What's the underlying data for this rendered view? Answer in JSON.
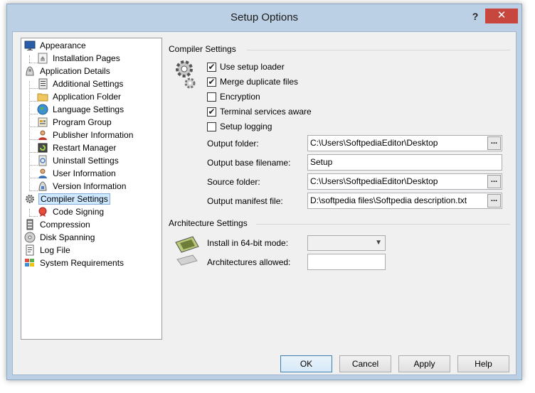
{
  "window": {
    "title": "Setup Options",
    "help_glyph": "?",
    "close_glyph": "✕"
  },
  "tree": {
    "items": [
      {
        "label": "Appearance",
        "icon": "monitor-icon"
      },
      {
        "label": "Installation Pages",
        "icon": "page-icon"
      },
      {
        "label": "Application Details",
        "icon": "app-icon"
      },
      {
        "label": "Additional Settings",
        "icon": "settings-icon"
      },
      {
        "label": "Application Folder",
        "icon": "folder-icon"
      },
      {
        "label": "Language Settings",
        "icon": "globe-icon"
      },
      {
        "label": "Program Group",
        "icon": "program-group-icon"
      },
      {
        "label": "Publisher Information",
        "icon": "user-icon"
      },
      {
        "label": "Restart Manager",
        "icon": "restart-icon"
      },
      {
        "label": "Uninstall Settings",
        "icon": "uninstall-icon"
      },
      {
        "label": "User Information",
        "icon": "user-info-icon"
      },
      {
        "label": "Version Information",
        "icon": "version-icon"
      },
      {
        "label": "Compiler Settings",
        "icon": "gear-icon"
      },
      {
        "label": "Code Signing",
        "icon": "certificate-icon"
      },
      {
        "label": "Compression",
        "icon": "compression-icon"
      },
      {
        "label": "Disk Spanning",
        "icon": "disk-icon"
      },
      {
        "label": "Log File",
        "icon": "log-icon"
      },
      {
        "label": "System Requirements",
        "icon": "windows-icon"
      }
    ],
    "selected": "Compiler Settings"
  },
  "compiler": {
    "section_title": "Compiler Settings",
    "checkboxes": [
      {
        "label": "Use setup loader",
        "checked": true
      },
      {
        "label": "Merge duplicate files",
        "checked": true
      },
      {
        "label": "Encryption",
        "checked": false
      },
      {
        "label": "Terminal services aware",
        "checked": true
      },
      {
        "label": "Setup logging",
        "checked": false
      }
    ],
    "check_mark": "✔",
    "fields": [
      {
        "label": "Output folder:",
        "value": "C:\\Users\\SoftpediaEditor\\Desktop",
        "browse": true
      },
      {
        "label": "Output base filename:",
        "value": "Setup",
        "browse": false
      },
      {
        "label": "Source folder:",
        "value": "C:\\Users\\SoftpediaEditor\\Desktop",
        "browse": true
      },
      {
        "label": "Output manifest file:",
        "value": "D:\\softpedia files\\Softpedia description.txt",
        "browse": true
      }
    ],
    "browse_label": "..."
  },
  "architecture": {
    "section_title": "Architecture Settings",
    "install_64_label": "Install in 64-bit mode:",
    "install_64_value": "",
    "allowed_label": "Architectures allowed:",
    "allowed_value": ""
  },
  "buttons": {
    "ok": "OK",
    "cancel": "Cancel",
    "apply": "Apply",
    "help": "Help"
  },
  "colors": {
    "title_bar": "#bcd0e5",
    "close_button": "#c7463d",
    "selection": "#cde8ff"
  }
}
